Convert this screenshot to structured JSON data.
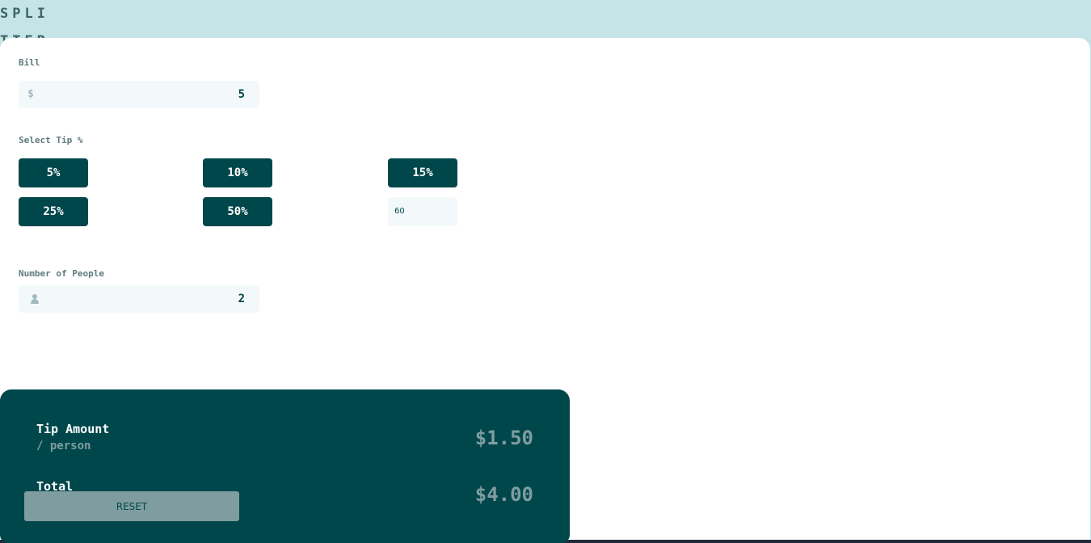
{
  "logo": {
    "line1": "SPLI",
    "line2": "TTER"
  },
  "bill": {
    "label": "Bill",
    "icon": "dollar-icon",
    "icon_glyph": "$",
    "value": "5"
  },
  "tip": {
    "label": "Select Tip %",
    "options": [
      "5%",
      "10%",
      "15%",
      "25%",
      "50%"
    ],
    "custom_value": "60"
  },
  "people": {
    "label": "Number of People",
    "icon": "person-icon",
    "value": "2"
  },
  "results": {
    "tip_title": "Tip Amount",
    "tip_sub": "/ person",
    "tip_amount": "$1.50",
    "total_title": "Total",
    "total_amount": "$4.00",
    "reset_label": "RESET"
  },
  "colors": {
    "header_bg": "#c5e4e7",
    "card_bg": "#ffffff",
    "accent": "#00474b",
    "muted": "#7f9d9f",
    "field_bg": "#f3f9fa"
  }
}
